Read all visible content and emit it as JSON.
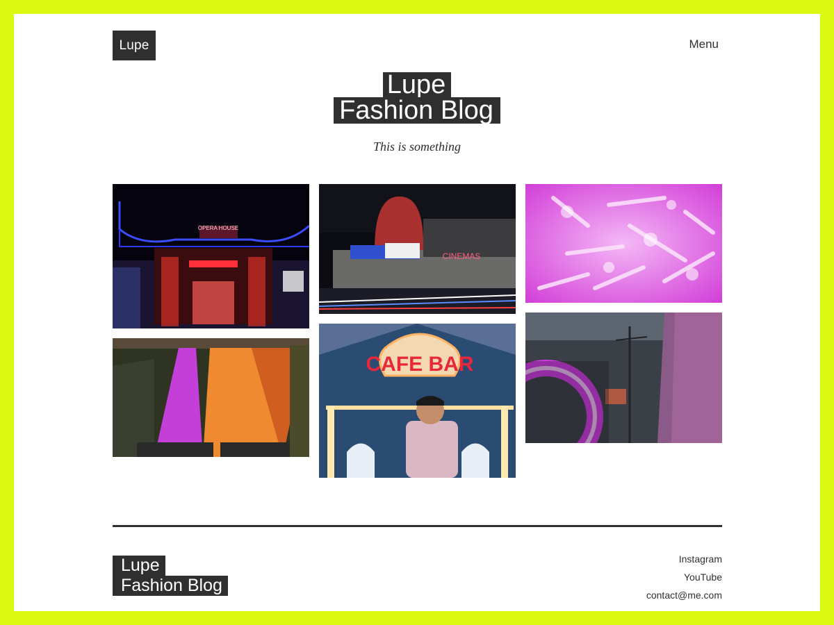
{
  "header": {
    "logo_text": "Lupe",
    "menu_label": "Menu"
  },
  "hero": {
    "title_line1": "Lupe",
    "title_line2": "Fashion Blog",
    "tagline": "This is something"
  },
  "gallery": {
    "items": [
      {
        "name": "opera-house-photo",
        "sign_text": "OPERA HOUSE"
      },
      {
        "name": "cinema-marquee-photo",
        "sign_text": "CINEMAS"
      },
      {
        "name": "pink-bokeh-photo"
      },
      {
        "name": "escalator-photo"
      },
      {
        "name": "cafe-bar-singer-photo",
        "sign_text": "CAFE BAR"
      },
      {
        "name": "neon-ring-photo"
      }
    ]
  },
  "footer": {
    "title_line1": "Lupe",
    "title_line2": "Fashion Blog",
    "links": [
      "Instagram",
      "YouTube",
      "contact@me.com"
    ]
  },
  "colors": {
    "page_border": "#dafa14",
    "background": "#ffffff",
    "ink": "#2f2f2f"
  }
}
